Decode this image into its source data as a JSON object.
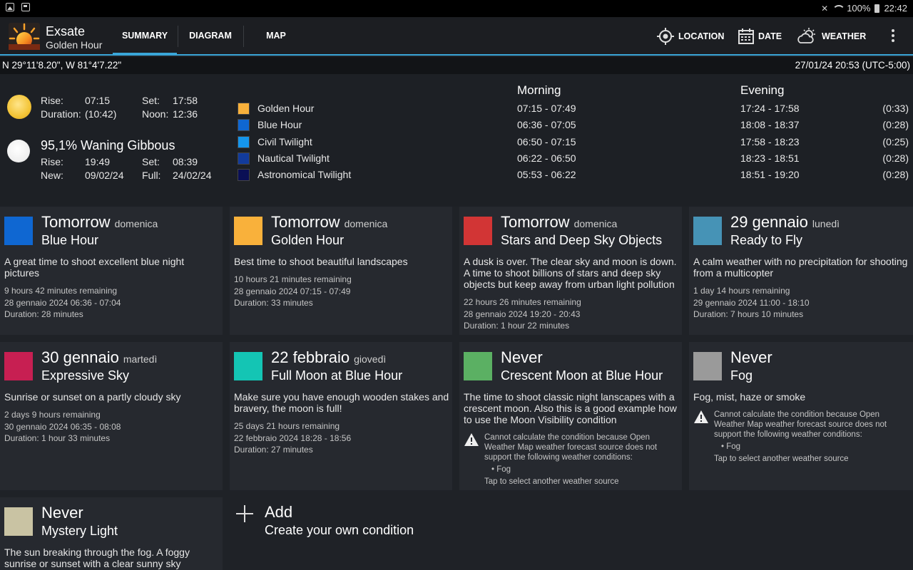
{
  "status_bar": {
    "battery": "100%",
    "time": "22:42"
  },
  "app": {
    "title": "Exsate",
    "subtitle": "Golden Hour"
  },
  "tabs": [
    {
      "label": "SUMMARY",
      "active": true
    },
    {
      "label": "DIAGRAM",
      "active": false
    },
    {
      "label": "MAP",
      "active": false
    }
  ],
  "actions": {
    "location": "LOCATION",
    "date": "DATE",
    "weather": "WEATHER"
  },
  "info_bar": {
    "coordinates": "N 29°11'8.20\", W 81°4'7.22\"",
    "datetime": "27/01/24 20:53 (UTC-5:00)"
  },
  "sun": {
    "rise_label": "Rise:",
    "rise": "07:15",
    "set_label": "Set:",
    "set": "17:58",
    "duration_label": "Duration:",
    "duration": "(10:42)",
    "noon_label": "Noon:",
    "noon": "12:36"
  },
  "moon": {
    "phase": "95,1% Waning Gibbous",
    "rise_label": "Rise:",
    "rise": "19:49",
    "set_label": "Set:",
    "set": "08:39",
    "new_label": "New:",
    "new": "09/02/24",
    "full_label": "Full:",
    "full": "24/02/24"
  },
  "legend": [
    {
      "label": "Golden Hour",
      "color": "#f9b13b"
    },
    {
      "label": "Blue Hour",
      "color": "#0f67d2"
    },
    {
      "label": "Civil Twilight",
      "color": "#1595ec"
    },
    {
      "label": "Nautical Twilight",
      "color": "#123b9c"
    },
    {
      "label": "Astronomical Twilight",
      "color": "#0a0f55"
    }
  ],
  "morning": {
    "heading": "Morning",
    "rows": [
      "07:15  -  07:49",
      "06:36  -  07:05",
      "06:50  -  07:15",
      "06:22  -  06:50",
      "05:53  -  06:22"
    ]
  },
  "evening": {
    "heading": "Evening",
    "rows": [
      "17:24  -  17:58",
      "18:08  -  18:37",
      "17:58  -  18:23",
      "18:23  -  18:51",
      "18:51  -  19:20"
    ],
    "durations": [
      "(0:33)",
      "(0:28)",
      "(0:25)",
      "(0:28)",
      "(0:28)"
    ]
  },
  "cards": [
    {
      "when": "Tomorrow",
      "day": "domenica",
      "name": "Blue Hour",
      "color": "#0f67d2",
      "desc": "A great time to shoot excellent blue night pictures",
      "remaining": "9 hours 42 minutes remaining",
      "date": "28 gennaio 2024 06:36 - 07:04",
      "duration": "Duration: 28 minutes"
    },
    {
      "when": "Tomorrow",
      "day": "domenica",
      "name": "Golden Hour",
      "color": "#f9b13b",
      "desc": "Best time to shoot beautiful landscapes",
      "remaining": "10 hours 21 minutes remaining",
      "date": "28 gennaio 2024 07:15 - 07:49",
      "duration": "Duration: 33 minutes"
    },
    {
      "when": "Tomorrow",
      "day": "domenica",
      "name": "Stars and Deep Sky Objects",
      "color": "#d23535",
      "desc": "A dusk is over. The clear sky and moon is down. A time to shoot billions of stars and deep sky objects but keep away from urban light pollution",
      "remaining": "22 hours 26 minutes remaining",
      "date": "28 gennaio 2024 19:20 - 20:43",
      "duration": "Duration: 1 hour 22 minutes"
    },
    {
      "when": "29 gennaio",
      "day": "lunedì",
      "name": "Ready to Fly",
      "color": "#4693b6",
      "desc": "A calm weather with no precipitation for shooting from a multicopter",
      "remaining": "1 day 14 hours remaining",
      "date": "29 gennaio 2024 11:00 - 18:10",
      "duration": "Duration: 7 hours 10 minutes"
    },
    {
      "when": "30 gennaio",
      "day": "martedì",
      "name": "Expressive Sky",
      "color": "#c71f52",
      "desc": "Sunrise or sunset on a partly cloudy sky",
      "remaining": "2 days 9 hours remaining",
      "date": "30 gennaio 2024 06:35 - 08:08",
      "duration": "Duration: 1 hour 33 minutes"
    },
    {
      "when": "22 febbraio",
      "day": "giovedì",
      "name": "Full Moon at Blue Hour",
      "color": "#14c5b4",
      "desc": "Make sure you have enough wooden stakes and bravery, the moon is full!",
      "remaining": "25 days 21 hours remaining",
      "date": "22 febbraio 2024 18:28 - 18:56",
      "duration": "Duration: 27 minutes"
    },
    {
      "when": "Never",
      "day": "",
      "name": "Crescent Moon at Blue Hour",
      "color": "#5bb063",
      "desc": "The time to shoot classic night lanscapes with a crescent moon. Also this is a good example how to use the Moon Visibility condition",
      "warning": "Cannot calculate the condition because Open Weather Map weather forecast source does not support the following weather conditions:",
      "bullet": "• Fog",
      "tap": "Tap to select another weather source"
    },
    {
      "when": "Never",
      "day": "",
      "name": "Fog",
      "color": "#9a9a9a",
      "desc": "Fog, mist, haze or smoke",
      "warning": "Cannot calculate the condition because Open Weather Map weather forecast source does not support the following weather conditions:",
      "bullet": "• Fog",
      "tap": "Tap to select another weather source"
    },
    {
      "when": "Never",
      "day": "",
      "name": "Mystery Light",
      "color": "#c9c3a3",
      "desc": "The sun breaking through the fog. A foggy sunrise or sunset with a clear sunny sky"
    }
  ],
  "add_card": {
    "title": "Add",
    "subtitle": "Create your own condition"
  }
}
